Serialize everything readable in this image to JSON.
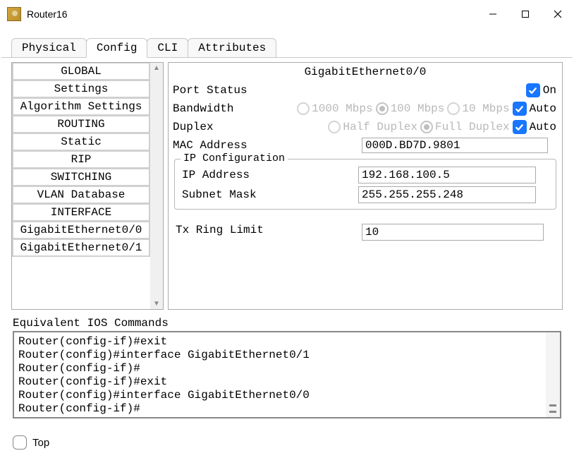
{
  "window": {
    "title": "Router16"
  },
  "tabs": [
    "Physical",
    "Config",
    "CLI",
    "Attributes"
  ],
  "active_tab": "Config",
  "sidebar": {
    "items": [
      {
        "label": "GLOBAL",
        "type": "header"
      },
      {
        "label": "Settings",
        "type": "item"
      },
      {
        "label": "Algorithm Settings",
        "type": "item"
      },
      {
        "label": "ROUTING",
        "type": "header"
      },
      {
        "label": "Static",
        "type": "item"
      },
      {
        "label": "RIP",
        "type": "item"
      },
      {
        "label": "SWITCHING",
        "type": "header"
      },
      {
        "label": "VLAN Database",
        "type": "item"
      },
      {
        "label": "INTERFACE",
        "type": "header"
      },
      {
        "label": "GigabitEthernet0/0",
        "type": "item"
      },
      {
        "label": "GigabitEthernet0/1",
        "type": "item"
      }
    ]
  },
  "content": {
    "title": "GigabitEthernet0/0",
    "port_status": {
      "label": "Port Status",
      "checked": true,
      "text": "On"
    },
    "bandwidth": {
      "label": "Bandwidth",
      "options": [
        "1000 Mbps",
        "100 Mbps",
        "10 Mbps"
      ],
      "selected": "100 Mbps",
      "auto_checked": true,
      "auto_label": "Auto"
    },
    "duplex": {
      "label": "Duplex",
      "options": [
        "Half Duplex",
        "Full Duplex"
      ],
      "selected": "Full Duplex",
      "auto_checked": true,
      "auto_label": "Auto"
    },
    "mac": {
      "label": "MAC Address",
      "value": "000D.BD7D.9801"
    },
    "ipconf": {
      "title": "IP Configuration",
      "ip": {
        "label": "IP Address",
        "value": "192.168.100.5"
      },
      "mask": {
        "label": "Subnet Mask",
        "value": "255.255.255.248"
      }
    },
    "txring": {
      "label": "Tx Ring Limit",
      "value": "10"
    }
  },
  "ios": {
    "title": "Equivalent IOS Commands",
    "lines": [
      "Router(config-if)#exit",
      "Router(config)#interface GigabitEthernet0/1",
      "Router(config-if)#",
      "Router(config-if)#exit",
      "Router(config)#interface GigabitEthernet0/0",
      "Router(config-if)#"
    ]
  },
  "footer": {
    "top_label": "Top",
    "top_checked": false
  }
}
